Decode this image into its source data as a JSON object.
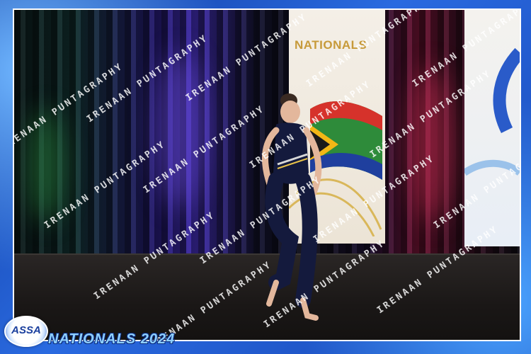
{
  "banner": {
    "title": "NATIONALS"
  },
  "watermark": {
    "text": "IRENAAN PUNTAGRAPHY"
  },
  "logo": {
    "text": "ASSA"
  },
  "footer": {
    "title": "NATIONALS 2024"
  },
  "colors": {
    "frame_blue": "#1d4fb8",
    "banner_gold": "#c79a3a",
    "footer_text": "#8fd0ff"
  }
}
